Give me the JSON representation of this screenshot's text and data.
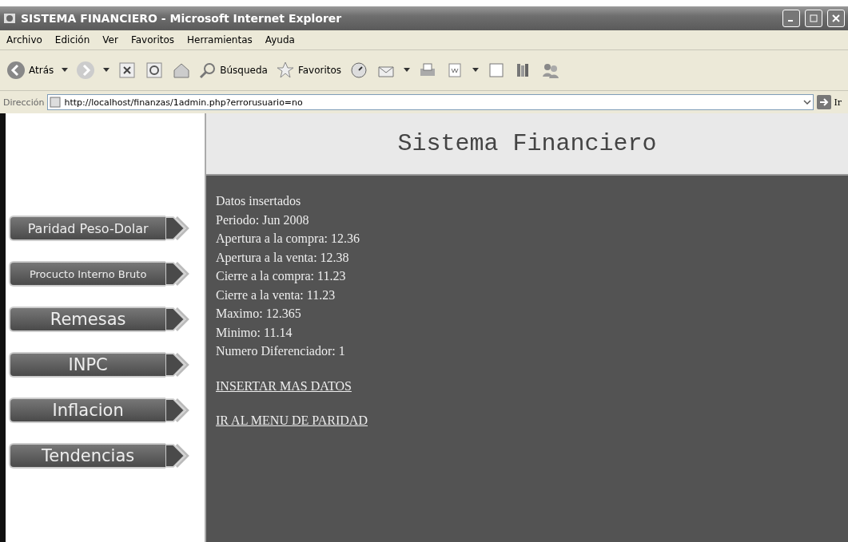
{
  "window": {
    "title": "SISTEMA FINANCIERO - Microsoft Internet Explorer"
  },
  "menu_bar": [
    "Archivo",
    "Edición",
    "Ver",
    "Favoritos",
    "Herramientas",
    "Ayuda"
  ],
  "toolbar": {
    "back": "Atrás",
    "search": "Búsqueda",
    "favorites": "Favoritos"
  },
  "address_bar": {
    "label": "Dirección",
    "value": "http://localhost/finanzas/1admin.php?errorusuario=no",
    "go": "Ir"
  },
  "page": {
    "header": "Sistema Financiero",
    "nav_buttons": [
      "Paridad Peso-Dolar",
      "Procucto Interno Bruto",
      "Remesas",
      "INPC",
      "Inflacion",
      "Tendencias"
    ],
    "lines": [
      "Datos insertados",
      "Periodo: Jun 2008",
      "Apertura a la compra: 12.36",
      "Apertura a la venta: 12.38",
      "Cierre a la compra: 11.23",
      "Cierre a la venta: 11.23",
      "Maximo: 12.365",
      "Minimo: 11.14",
      "Numero Diferenciador: 1"
    ],
    "links": [
      "INSERTAR MAS DATOS",
      "IR AL MENU DE PARIDAD"
    ]
  }
}
